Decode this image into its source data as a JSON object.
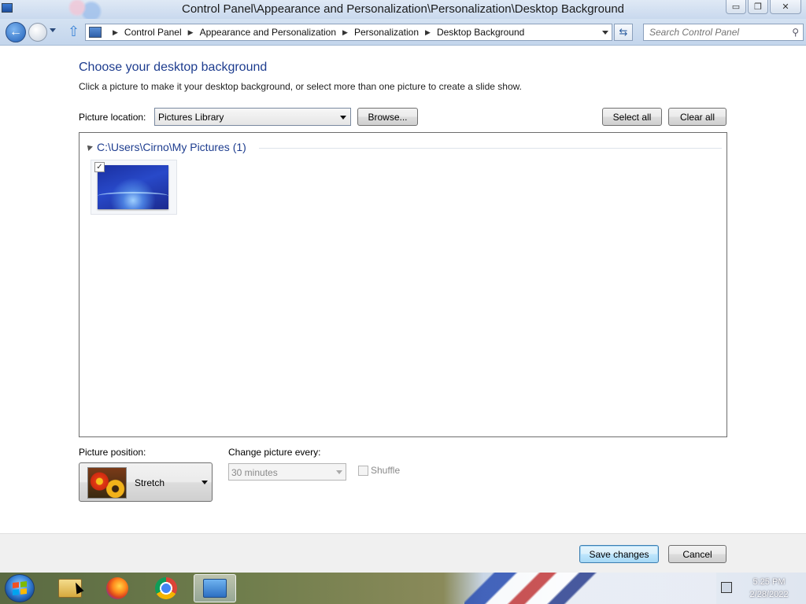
{
  "window": {
    "title": "Control Panel\\Appearance and Personalization\\Personalization\\Desktop Background",
    "minimize": "▭",
    "maximize": "❐",
    "close": "✕"
  },
  "nav": {
    "breadcrumbs": [
      "Control Panel",
      "Appearance and Personalization",
      "Personalization",
      "Desktop Background"
    ],
    "search_placeholder": "Search Control Panel"
  },
  "page": {
    "heading": "Choose your desktop background",
    "subtext": "Click a picture to make it your desktop background, or select more than one picture to create a slide show.",
    "picture_location_label": "Picture location:",
    "picture_location_value": "Pictures Library",
    "browse_label": "Browse...",
    "select_all_label": "Select all",
    "clear_all_label": "Clear all",
    "group_header": "C:\\Users\\Cirno\\My Pictures (1)",
    "thumbnail_checked": "✓",
    "picture_position_label": "Picture position:",
    "picture_position_value": "Stretch",
    "change_picture_label": "Change picture every:",
    "change_picture_value": "30 minutes",
    "shuffle_label": "Shuffle"
  },
  "footer": {
    "save_label": "Save changes",
    "cancel_label": "Cancel"
  },
  "taskbar": {
    "items": [
      "windows-explorer",
      "firefox",
      "chrome",
      "control-panel"
    ],
    "time": "5:25 PM",
    "date": "2/28/2022"
  }
}
